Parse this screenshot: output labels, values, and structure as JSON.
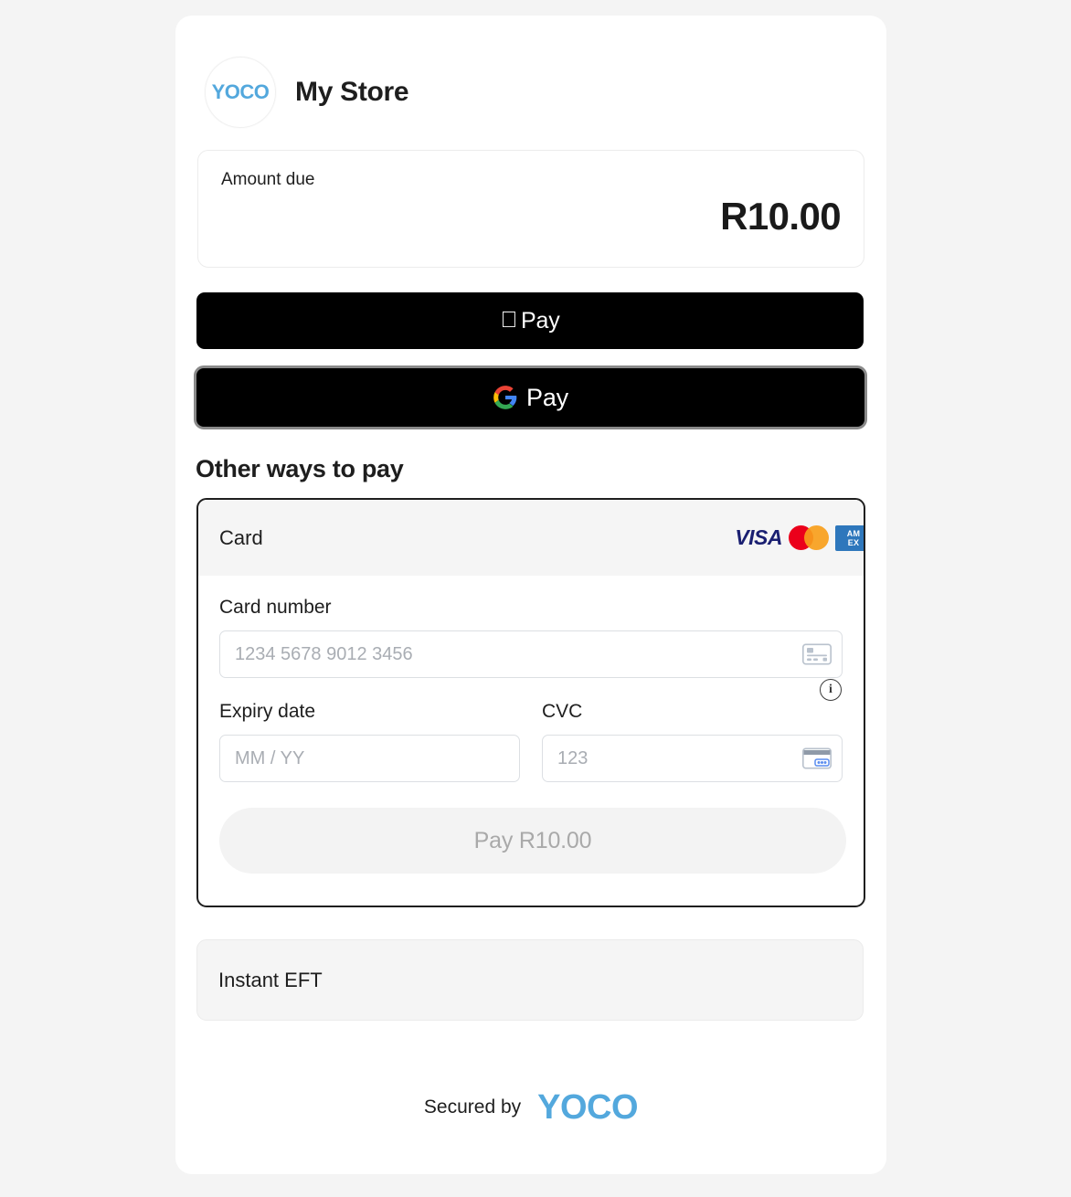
{
  "merchant": {
    "logo_text": "YOCO",
    "logo_icon": "yoco-logo-icon",
    "name": "My Store"
  },
  "amount": {
    "label": "Amount due",
    "value": "R10.00"
  },
  "express_pay": {
    "apple_pay": {
      "label": "Pay",
      "icon": "apple-logo-icon"
    },
    "google_pay": {
      "label": "Pay",
      "icon": "google-logo-icon"
    }
  },
  "other_ways": {
    "heading": "Other ways to pay"
  },
  "card_method": {
    "title": "Card",
    "brands": [
      "VISA",
      "Mastercard",
      "AMEX"
    ],
    "amex_line1": "AM",
    "amex_line2": "EX",
    "fields": {
      "card_number": {
        "label": "Card number",
        "placeholder": "1234 5678 9012 3456",
        "value": "",
        "icon": "credit-card-icon"
      },
      "expiry": {
        "label": "Expiry date",
        "placeholder": "MM / YY",
        "value": ""
      },
      "cvc": {
        "label": "CVC",
        "placeholder": "123",
        "value": "",
        "icon": "cvc-card-icon"
      }
    },
    "info_icon": "info-icon",
    "info_glyph": "i",
    "submit_label": "Pay R10.00"
  },
  "eft_method": {
    "title": "Instant EFT"
  },
  "footer": {
    "secured_text": "Secured by",
    "brand": "YOCO"
  },
  "colors": {
    "page_background": "#f4f4f4",
    "card_background": "#ffffff",
    "yoco_blue": "#53a8dd",
    "express_button": "#000000",
    "visa_blue": "#1a1f71",
    "mastercard_red": "#eb001b",
    "mastercard_orange": "#f79e1b",
    "amex_blue": "#2e77bc",
    "selected_border": "#1f1f1f",
    "muted_text": "#a9adb3"
  }
}
